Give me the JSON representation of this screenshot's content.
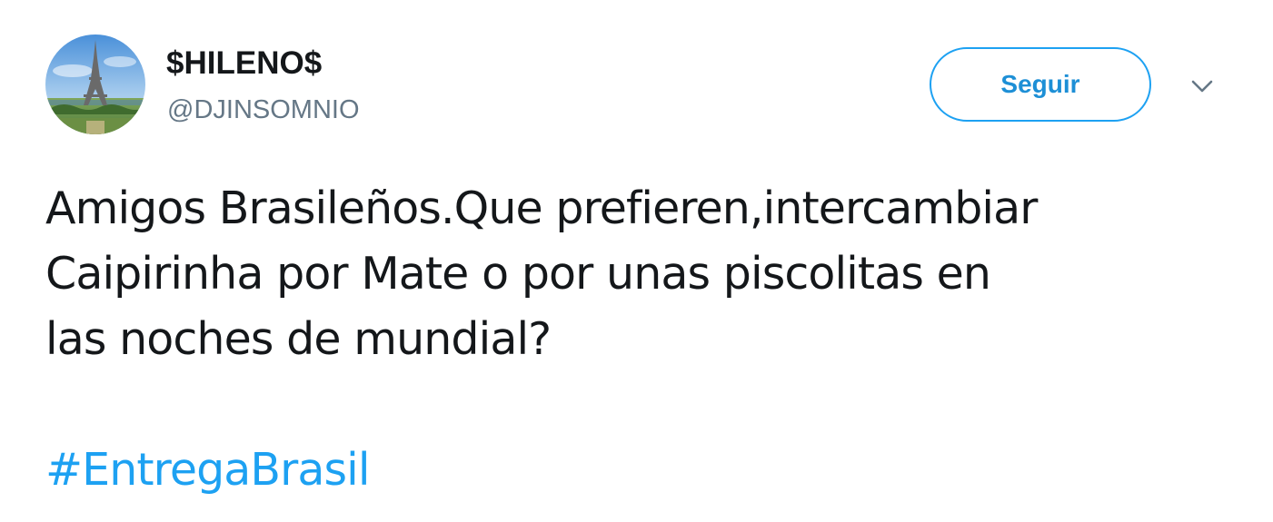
{
  "tweet": {
    "author": {
      "display_name": "$HILENO$",
      "username": "@DJINSOMNIO",
      "avatar_icon": "eiffel-tower-avatar"
    },
    "follow_button_label": "Seguir",
    "menu_icon": "chevron-down-icon",
    "text_lines": [
      "Amigos Brasileños.Que prefieren,intercambiar",
      "Caipirinha por Mate o por unas piscolitas en",
      "las noches de mundial?"
    ],
    "hashtag": "#EntregaBrasil"
  },
  "colors": {
    "accent": "#1da1f2",
    "text": "#14171a",
    "secondary_text": "#657786"
  }
}
